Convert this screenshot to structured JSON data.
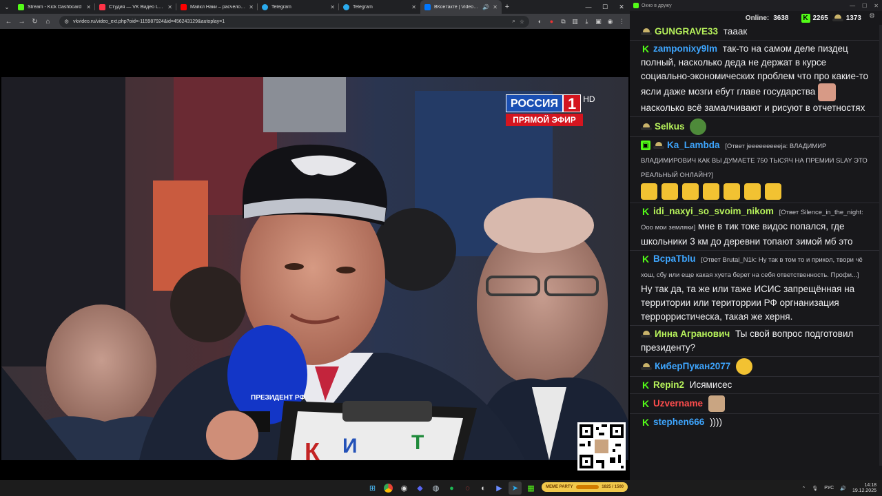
{
  "browser": {
    "tabs": [
      {
        "label": "Stream - Kick Dashboard",
        "color": "#53fc18"
      },
      {
        "label": "Студия — VK Видео Live",
        "color": "#ff3347"
      },
      {
        "label": "Майкл Наки – расчеловечиван...",
        "color": "#ff0000"
      },
      {
        "label": "Telegram",
        "color": "#2aabee"
      },
      {
        "label": "Telegram",
        "color": "#2aabee"
      },
      {
        "label": "ВКонтакте | Video Ext",
        "color": "#0077ff"
      }
    ],
    "url": "vkvideo.ru/video_ext.php?oid=-115987924&id=456243129&autoplay=1"
  },
  "video": {
    "channel_logo": "РОССИЯ",
    "channel_number": "1",
    "channel_hd": "HD",
    "live_label": "ПРЯМОЙ ЭФИР",
    "mic_label": "ПРЕЗИДЕНТ РФ"
  },
  "chat": {
    "window_title": "Окно в дружу",
    "online_label": "Online:",
    "online_count": "3638",
    "kick_count": "2265",
    "vk_count": "1373",
    "messages": [
      {
        "badge": "hat",
        "user": "GUNGRAVE33",
        "color": "#b6f15b",
        "text": "тааак"
      },
      {
        "badge": "k",
        "user": "zamponixy9lm",
        "color": "#3ea6ff",
        "text": "так-то на самом деле пиздец полный, насколько деда не держат в курсе социально-экономических проблем что про какие-то ясли даже мозги ебут главе государства",
        "text2": "насколько всё замалчивают и рисуют в отчетностях"
      },
      {
        "badge": "hat",
        "user": "Selkus",
        "color": "#b6f15b",
        "text": ""
      },
      {
        "badge": "hat2",
        "user": "Ka_Lambda",
        "color": "#3ea6ff",
        "reply": "[Ответ jeeeeeeeeeja: ВЛАДИМИР ВЛАДИМИРОВИЧ КАК ВЫ ДУМАЕТЕ 750 ТЫСЯЧ НА ПРЕМИИ SLAY ЭТО РЕАЛЬНЫЙ ОНЛАЙН?]",
        "text": ""
      },
      {
        "badge": "k",
        "user": "idi_naxyi_so_svoim_nikom",
        "color": "#b6f15b",
        "reply": "[Ответ Silence_in_the_night: Ооо мои земляки]",
        "text": "мне в тик токе видос попался, где школьники 3 км до деревни топают зимой мб это"
      },
      {
        "badge": "k",
        "user": "ВсраТblu",
        "color": "#3ea6ff",
        "reply": "[Ответ Brutal_N1k: Ну так в том то и прикол, твори чё хош, сбу или еще какая хуета берет на себя ответственность. Профи...]",
        "text": "Ну так да, та же или таже ИСИС запрещённая на территории или територрии РФ оргнанизация террорристическа, такая же херня."
      },
      {
        "badge": "hat",
        "user": "Инна Агранович",
        "color": "#b6f15b",
        "text": "Ты свой вопрос подготовил президенту?"
      },
      {
        "badge": "hat",
        "user": "КиберПукан2077",
        "color": "#3ea6ff",
        "text": ""
      },
      {
        "badge": "k",
        "user": "Repin2",
        "color": "#b6f15b",
        "text": "Исямисес"
      },
      {
        "badge": "k",
        "user": "Uzvername",
        "color": "#ff4d4d",
        "text": ""
      },
      {
        "badge": "k",
        "user": "stephen666",
        "color": "#3ea6ff",
        "text": "))))"
      }
    ]
  },
  "taskbar": {
    "meme_widget": "MEME PARTY",
    "meme_progress": "1825 / 1500",
    "lang": "РУС",
    "time": "14:18",
    "date": "19.12.2025"
  },
  "colors": {
    "kick_green": "#53fc18",
    "rossiya_blue": "#1a4fb3",
    "rossiya_red": "#d4151f"
  }
}
